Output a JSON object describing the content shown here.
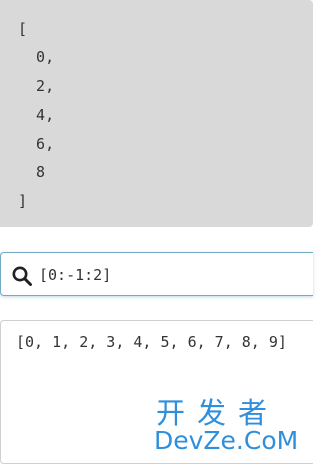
{
  "output": {
    "lines": [
      "[",
      "  0,",
      "  2,",
      "  4,",
      "  6,",
      "  8",
      "]"
    ]
  },
  "query": {
    "value": "[0:-1:2]",
    "icon": "search-icon"
  },
  "input": {
    "value": "[0, 1, 2, 3, 4, 5, 6, 7, 8, 9]"
  },
  "watermark": {
    "chinese": "开发者",
    "english": "DevZe.CoM"
  },
  "colors": {
    "output_bg": "#d9d9d9",
    "query_border": "#74a9c8",
    "watermark": "#2f8fdc"
  }
}
